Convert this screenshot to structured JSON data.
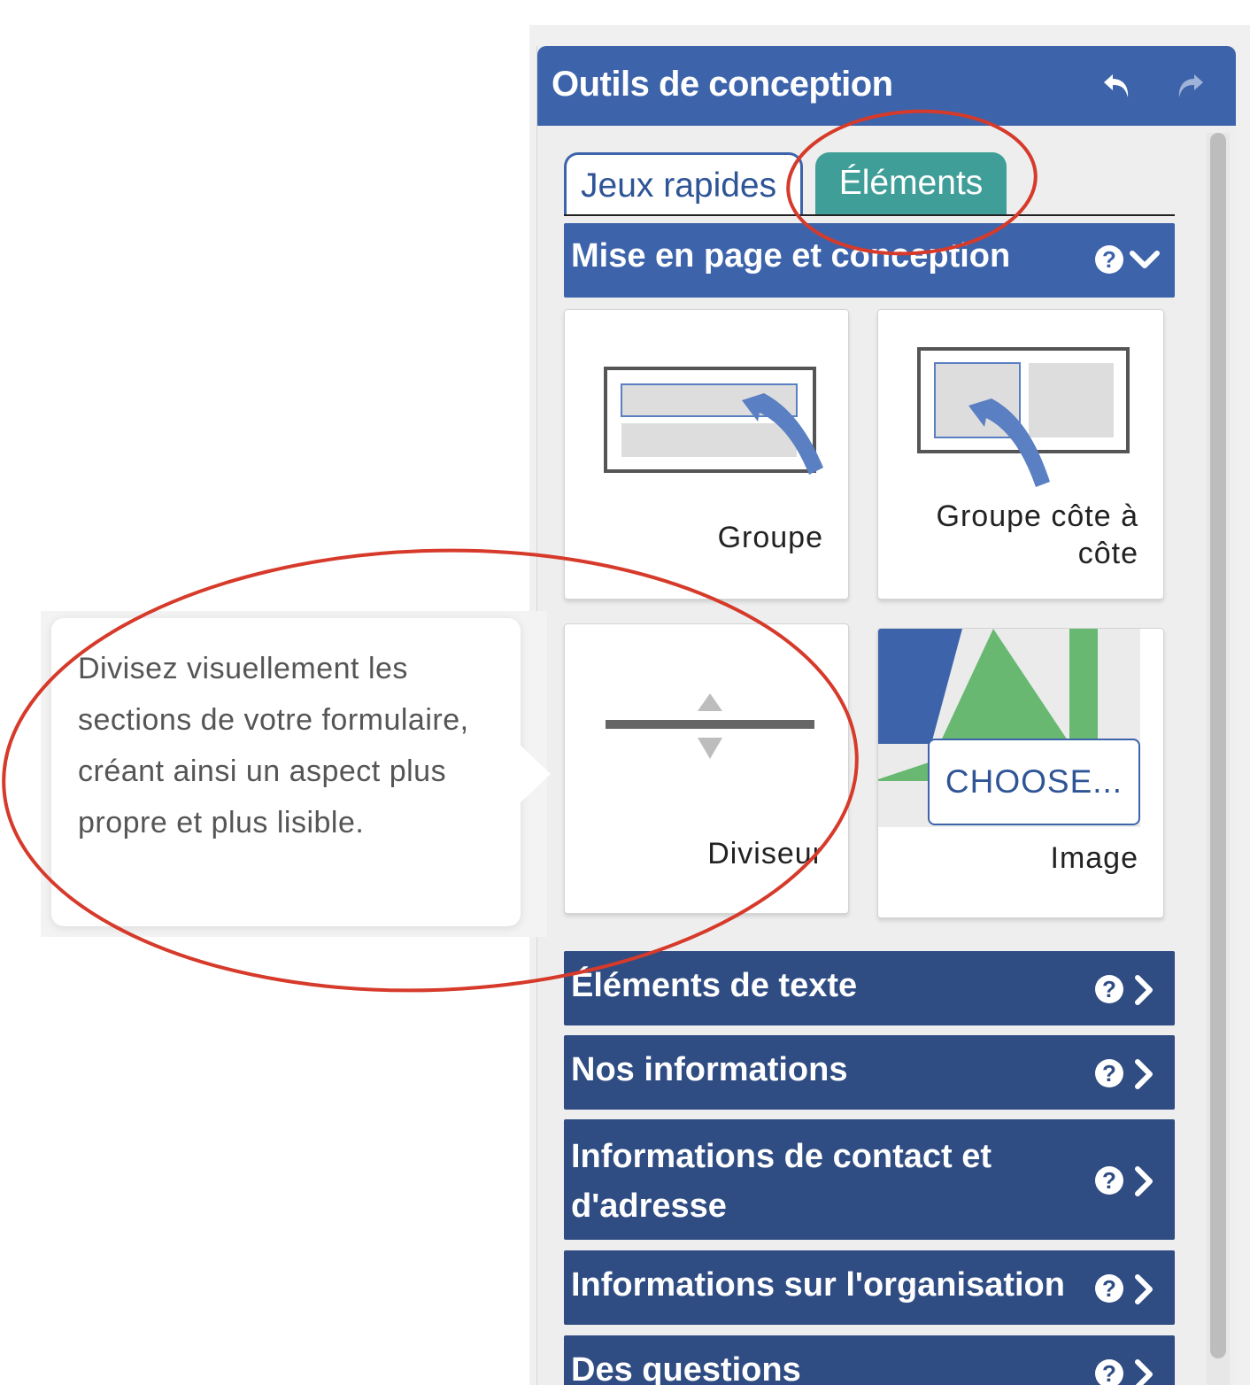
{
  "panel": {
    "title": "Outils de conception",
    "undo_icon": "undo-icon",
    "redo_icon": "redo-icon",
    "header_color": "#3d64ab"
  },
  "tabs": [
    {
      "label": "Jeux rapides",
      "active": true
    },
    {
      "label": "Éléments",
      "active": false,
      "color": "#3f9f98"
    }
  ],
  "sections": {
    "layout": {
      "label": "Mise en page et conception",
      "expanded": true
    },
    "collapsed": [
      {
        "label": "Éléments de texte"
      },
      {
        "label": "Nos informations"
      },
      {
        "label": "Informations de contact et d'adresse"
      },
      {
        "label": "Informations sur l'organisation"
      },
      {
        "label": "Des questions"
      }
    ]
  },
  "tiles": {
    "group": {
      "label": "Groupe",
      "icon": "group-layout-icon"
    },
    "side_group": {
      "label": "Groupe côte à côte",
      "icon": "side-by-side-group-icon"
    },
    "divider": {
      "label": "Diviseur",
      "icon": "divider-icon"
    },
    "image": {
      "label": "Image",
      "button": "CHOOSE...",
      "icon": "image-placeholder-icon"
    }
  },
  "tooltip": {
    "text": "Divisez visuellement les sections de votre formulaire, créant ainsi un aspect plus propre et plus lisible."
  },
  "help_icon": "?",
  "annotation_color": "#d63a2a"
}
